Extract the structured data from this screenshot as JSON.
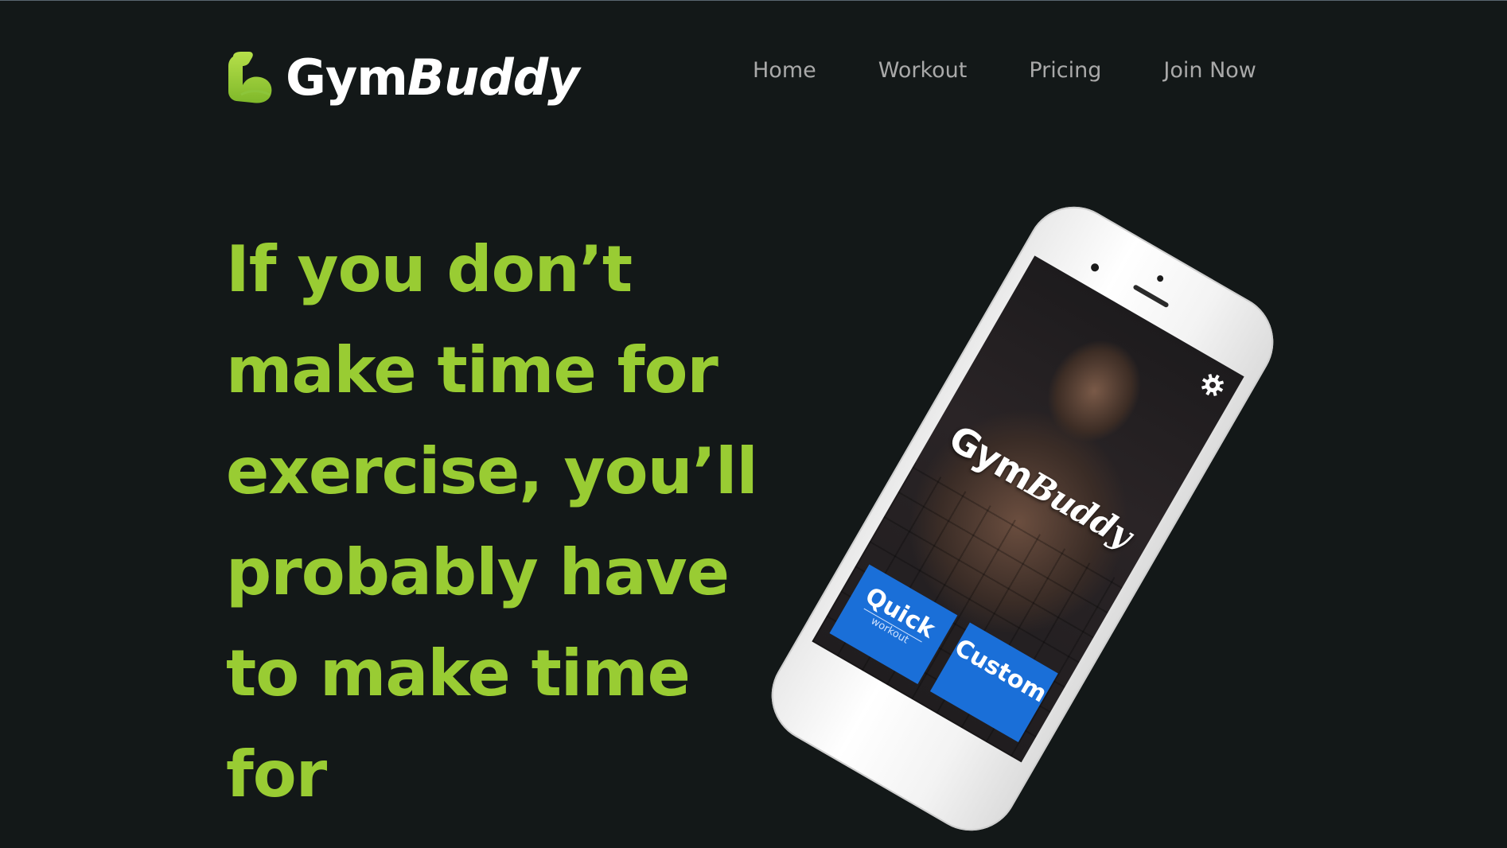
{
  "brand": {
    "name_regular": "Gym",
    "name_italic": "Buddy",
    "accent_color": "#99cc33",
    "logo_icon": "flexed-arm-icon"
  },
  "nav": {
    "items": [
      {
        "label": "Home"
      },
      {
        "label": "Workout"
      },
      {
        "label": "Pricing"
      },
      {
        "label": "Join Now"
      }
    ]
  },
  "hero": {
    "headline": "If you don’t make time for exercise, you’ll probably have to make time for"
  },
  "phone": {
    "app_logo_regular": "Gym",
    "app_logo_italic": "Buddy",
    "settings_icon": "gear-icon",
    "tiles": [
      {
        "title": "Quick",
        "subtitle": "workout"
      },
      {
        "title": "Custom",
        "subtitle": ""
      }
    ],
    "tile_color": "#1a6fd8"
  },
  "colors": {
    "background": "#131818",
    "nav_text": "#a9a9a9",
    "headline": "#99cc33"
  }
}
